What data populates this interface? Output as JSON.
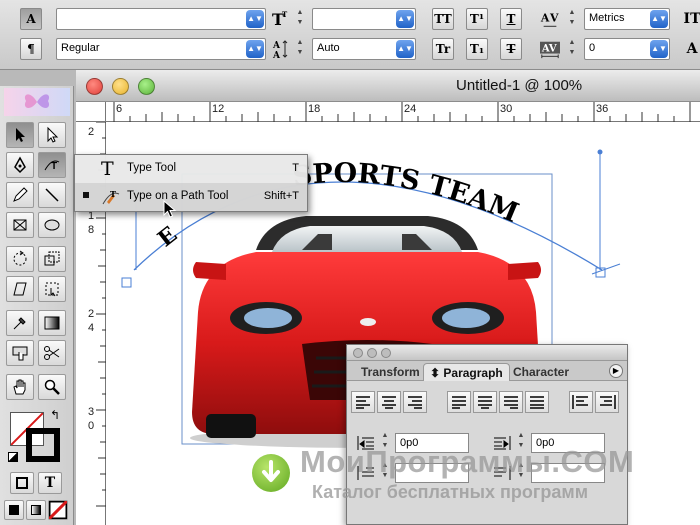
{
  "control_bar": {
    "font_family_value": "",
    "font_style_value": "Regular",
    "font_size_value": "",
    "leading_value": "Auto",
    "kerning_value": "Metrics",
    "tracking_value": "0",
    "type_button_label": "A",
    "paragraph_button_label": "¶",
    "all_caps_label": "TT",
    "superscript_label": "T¹",
    "underline_label": "T",
    "small_caps_label": "Tr",
    "subscript_label": "T₁",
    "strikethrough_label": "T"
  },
  "document": {
    "title": "Untitled-1 @ 100%",
    "ruler_top_ticks": [
      "6",
      "12",
      "18",
      "24",
      "30",
      "36"
    ],
    "ruler_left_ticks": [
      "2",
      "1",
      "8",
      "2",
      "4",
      "3",
      "0"
    ],
    "curved_text": "SPORTS TEAM",
    "curved_text_prefix": "E"
  },
  "flyout": {
    "items": [
      {
        "icon": "type-icon",
        "glyph": "T",
        "label": "Type Tool",
        "shortcut": "T",
        "selected": false
      },
      {
        "icon": "type-on-path-icon",
        "glyph": "",
        "label": "Type on a Path Tool",
        "shortcut": "Shift+T",
        "selected": true
      }
    ]
  },
  "toolbox": {
    "fill_stroke_glyph": "T"
  },
  "paragraph_panel": {
    "tabs": [
      {
        "label": "Transform",
        "active": false
      },
      {
        "label": "Paragraph",
        "active": true
      },
      {
        "label": "Character",
        "active": false
      }
    ],
    "left_indent_value": "0p0",
    "right_indent_value": "0p0"
  },
  "watermark": {
    "title": "МоиПрограммы.COM",
    "subtitle": "Каталог бесплатных программ"
  },
  "colors": {
    "dropdown_accent": "#2f6fd6",
    "car_red": "#d81a1a",
    "path_blue": "#4a7fd4",
    "close_red": "#e0403a",
    "minimize_yellow": "#e8b42e",
    "zoom_green": "#5cb33a"
  }
}
